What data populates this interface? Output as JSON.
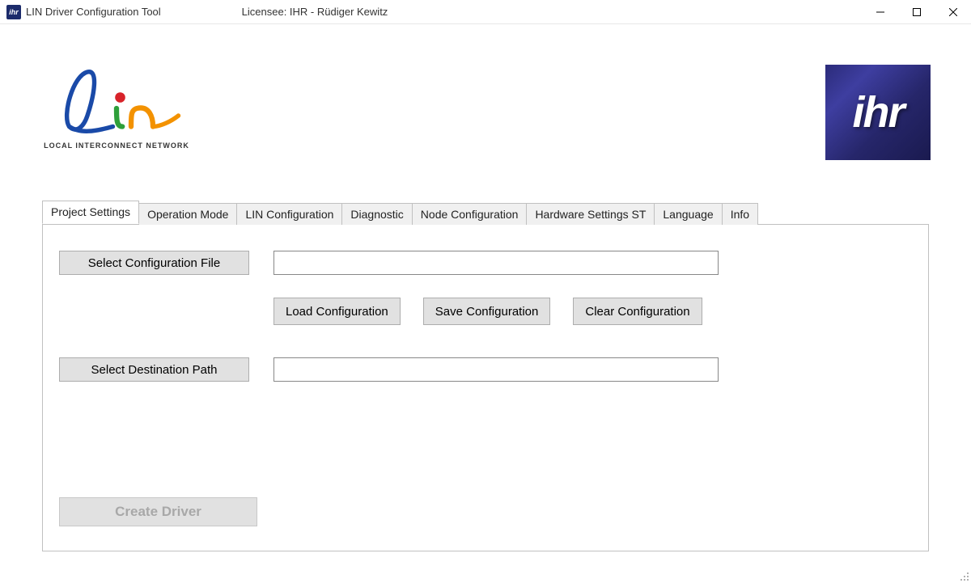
{
  "window": {
    "title": "LIN Driver Configuration Tool",
    "licensee": "Licensee:  IHR - Rüdiger Kewitz",
    "app_icon_text": "ihr"
  },
  "logos": {
    "lin_subtitle": "LOCAL INTERCONNECT NETWORK",
    "ihr_text": "ihr"
  },
  "tabs": [
    {
      "label": "Project Settings",
      "active": true
    },
    {
      "label": "Operation Mode",
      "active": false
    },
    {
      "label": "LIN Configuration",
      "active": false
    },
    {
      "label": "Diagnostic",
      "active": false
    },
    {
      "label": "Node Configuration",
      "active": false
    },
    {
      "label": "Hardware Settings ST",
      "active": false
    },
    {
      "label": "Language",
      "active": false
    },
    {
      "label": "Info",
      "active": false
    }
  ],
  "project_settings": {
    "select_config_file_btn": "Select Configuration File",
    "config_file_value": "",
    "load_config_btn": "Load Configuration",
    "save_config_btn": "Save Configuration",
    "clear_config_btn": "Clear Configuration",
    "select_dest_path_btn": "Select Destination Path",
    "dest_path_value": "",
    "create_driver_btn": "Create Driver",
    "create_driver_enabled": false
  }
}
